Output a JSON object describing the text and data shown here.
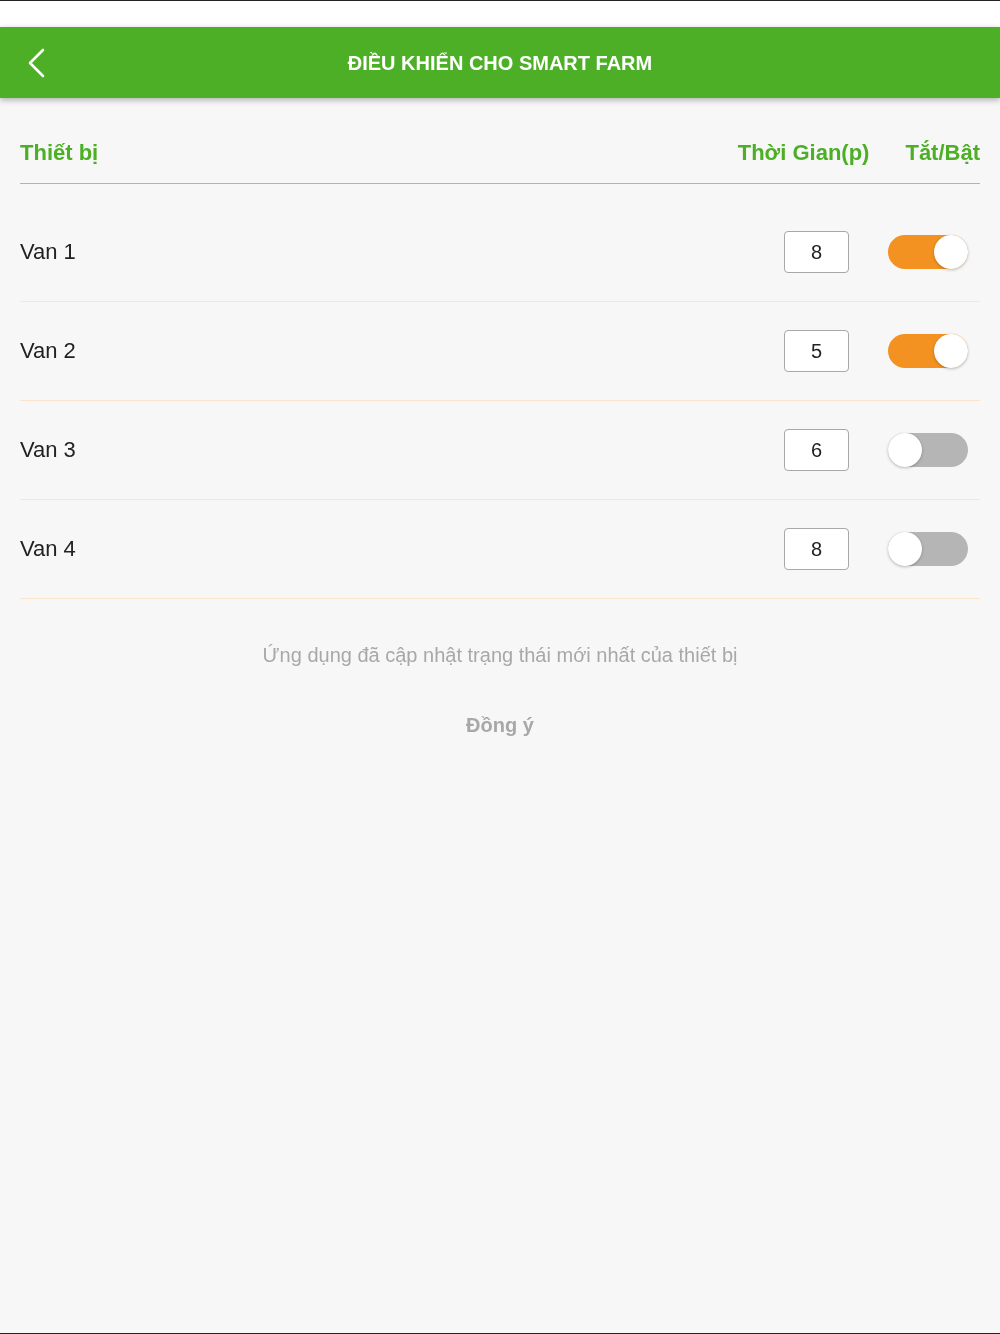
{
  "header": {
    "title": "ĐIỀU KHIỂN CHO SMART FARM"
  },
  "table": {
    "columns": [
      "Thiết bị",
      "Thời Gian(p)",
      "Tắt/Bật"
    ],
    "rows": [
      {
        "device": "Van 1",
        "time": "8",
        "on": true
      },
      {
        "device": "Van 2",
        "time": "5",
        "on": true
      },
      {
        "device": "Van 3",
        "time": "6",
        "on": false
      },
      {
        "device": "Van 4",
        "time": "8",
        "on": false
      }
    ]
  },
  "toast": {
    "message": "Ứng dụng đã cập nhật trạng thái mới nhất của thiết bị",
    "button": "Đồng ý"
  }
}
